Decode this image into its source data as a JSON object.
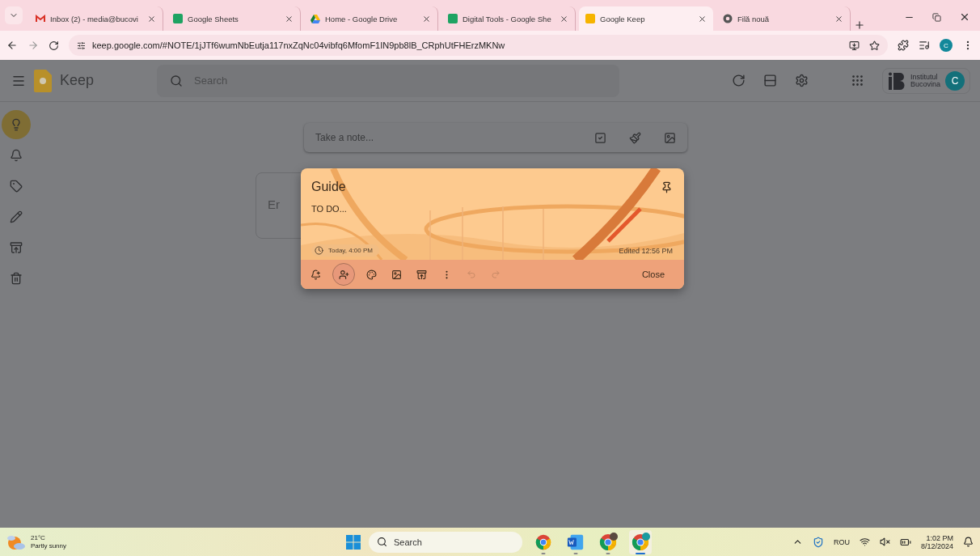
{
  "browser": {
    "tabs": [
      {
        "label": "Inbox (2) - media@bucovi",
        "kind": "gmail",
        "selected": false
      },
      {
        "label": "Google Sheets",
        "kind": "sheets",
        "selected": false
      },
      {
        "label": "Home - Google Drive",
        "kind": "drive",
        "selected": false
      },
      {
        "label": "Digital Tools - Google She",
        "kind": "sheets",
        "selected": false
      },
      {
        "label": "Google Keep",
        "kind": "keep",
        "selected": true
      },
      {
        "label": "Filă nouă",
        "kind": "chrome",
        "selected": false
      }
    ],
    "url": "keep.google.com/#NOTE/1jJTf6wumNbEutja117nxZqNc04vibfq6MfomF1IN9pb8lB_CRphUtFHErzMKNw",
    "profile_initial": "C"
  },
  "keep": {
    "app_name": "Keep",
    "search_placeholder": "Search",
    "account_initial": "C",
    "org_logo_line1": "Institutul",
    "org_logo_line2": "Bucovina",
    "sidebar": {
      "items": [
        {
          "kind": "notes",
          "selected": true
        },
        {
          "kind": "reminders",
          "selected": false
        },
        {
          "kind": "labels",
          "selected": false
        },
        {
          "kind": "edit",
          "selected": false
        },
        {
          "kind": "archive",
          "selected": false
        },
        {
          "kind": "trash",
          "selected": false
        }
      ]
    },
    "note_input": {
      "placeholder": "Take a note..."
    },
    "background_note": {
      "text": "Er"
    },
    "open_note": {
      "title": "Guide",
      "body": "TO DO...",
      "reminder": "Today, 4:00 PM",
      "edited": "Edited 12:56 PM",
      "close_label": "Close"
    }
  },
  "taskbar": {
    "temperature": "21°C",
    "condition": "Partly sunny",
    "search_placeholder": "Search",
    "apps": [
      {
        "kind": "chrome",
        "selected": false
      },
      {
        "kind": "word",
        "selected": false
      },
      {
        "kind": "chrome-profile",
        "selected": false
      },
      {
        "kind": "chrome-c",
        "selected": true
      }
    ],
    "language": "ROU",
    "time": "1:02 PM",
    "date": "8/12/2024"
  }
}
